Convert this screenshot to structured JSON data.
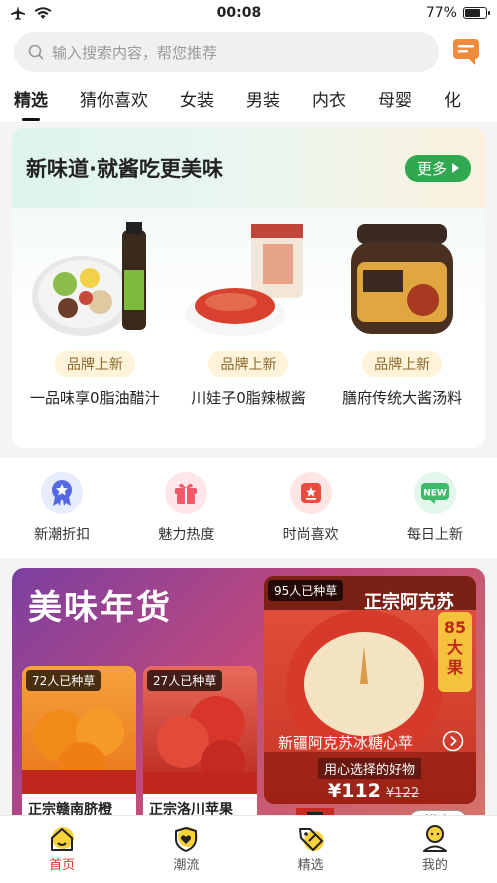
{
  "status": {
    "time": "00:08",
    "battery_text": "77%",
    "battery_level": 0.77
  },
  "search": {
    "placeholder": "输入搜索内容，帮您推荐"
  },
  "tabs": [
    {
      "label": "精选",
      "active": true
    },
    {
      "label": "猜你喜欢"
    },
    {
      "label": "女装"
    },
    {
      "label": "男装"
    },
    {
      "label": "内衣"
    },
    {
      "label": "母婴"
    },
    {
      "label": "化"
    }
  ],
  "promo": {
    "title": "新味道·就酱吃更美味",
    "more_label": "更多",
    "products": [
      {
        "badge": "品牌上新",
        "name": "一品味享0脂油醋汁"
      },
      {
        "badge": "品牌上新",
        "name": "川娃子0脂辣椒酱"
      },
      {
        "badge": "品牌上新",
        "name": "膳府传统大酱汤料"
      }
    ]
  },
  "quick_links": [
    {
      "label": "新潮折扣",
      "icon": "medal-icon"
    },
    {
      "label": "魅力热度",
      "icon": "gift-icon"
    },
    {
      "label": "时尚喜欢",
      "icon": "star-box-icon"
    },
    {
      "label": "每日上新",
      "icon": "new-icon"
    }
  ],
  "feature": {
    "title": "美味年货",
    "cards": [
      {
        "count": "72人已种草",
        "name": "正宗赣南脐橙"
      },
      {
        "count": "27人已种草",
        "name": "正宗洛川苹果"
      }
    ],
    "big_card": {
      "count": "95人已种草",
      "banner": "正宗阿克苏",
      "corner": "85大果",
      "name": "新疆阿克苏冰糖心苹",
      "subtitle": "用心选择的好物",
      "price": "¥112",
      "original_price": "¥122"
    },
    "store_button": "进店"
  },
  "bottom_nav": [
    {
      "label": "首页",
      "icon": "home-icon",
      "active": true
    },
    {
      "label": "潮流",
      "icon": "heart-shield-icon"
    },
    {
      "label": "精选",
      "icon": "tag-icon"
    },
    {
      "label": "我的",
      "icon": "user-icon"
    }
  ],
  "colors": {
    "accent_red": "#e2322a",
    "more_green": "#2fa84f"
  }
}
